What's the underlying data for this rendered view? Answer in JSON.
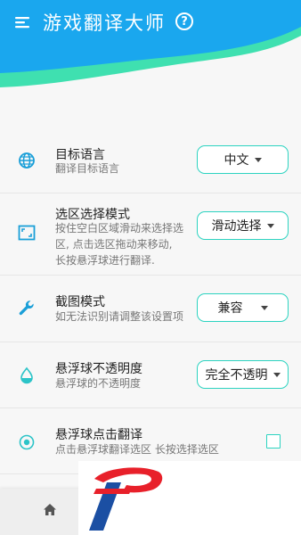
{
  "app": {
    "title": "游戏翻译大师",
    "help_label": "?"
  },
  "settings": [
    {
      "icon": "globe-icon",
      "title": "目标语言",
      "desc": [
        "翻译目标语言"
      ],
      "control": "dropdown",
      "value": "中文"
    },
    {
      "icon": "crop-frame-icon",
      "title": "选区选择模式",
      "desc": [
        "按住空白区域滑动来选择选",
        "区, 点击选区拖动来移动,",
        "长按悬浮球进行翻译."
      ],
      "control": "dropdown",
      "value": "滑动选择"
    },
    {
      "icon": "wrench-icon",
      "title": "截图模式",
      "desc": [
        "如无法识别请调整该设置项"
      ],
      "control": "dropdown",
      "value": "兼容"
    },
    {
      "icon": "water-drop-icon",
      "title": "悬浮球不透明度",
      "desc": [
        "悬浮球的不透明度"
      ],
      "control": "dropdown",
      "value": "完全不透明"
    },
    {
      "icon": "radio-target-icon",
      "title": "悬浮球点击翻译",
      "desc": [
        "点击悬浮球翻译选区 长按选择选区"
      ],
      "control": "checkbox",
      "checked": false
    }
  ],
  "colors": {
    "header_blue": "#1aa7ee",
    "header_green": "#3fe0b0",
    "accent": "#2cd3c0",
    "logo_red": "#e8202a",
    "logo_blue": "#1b4fa3"
  }
}
